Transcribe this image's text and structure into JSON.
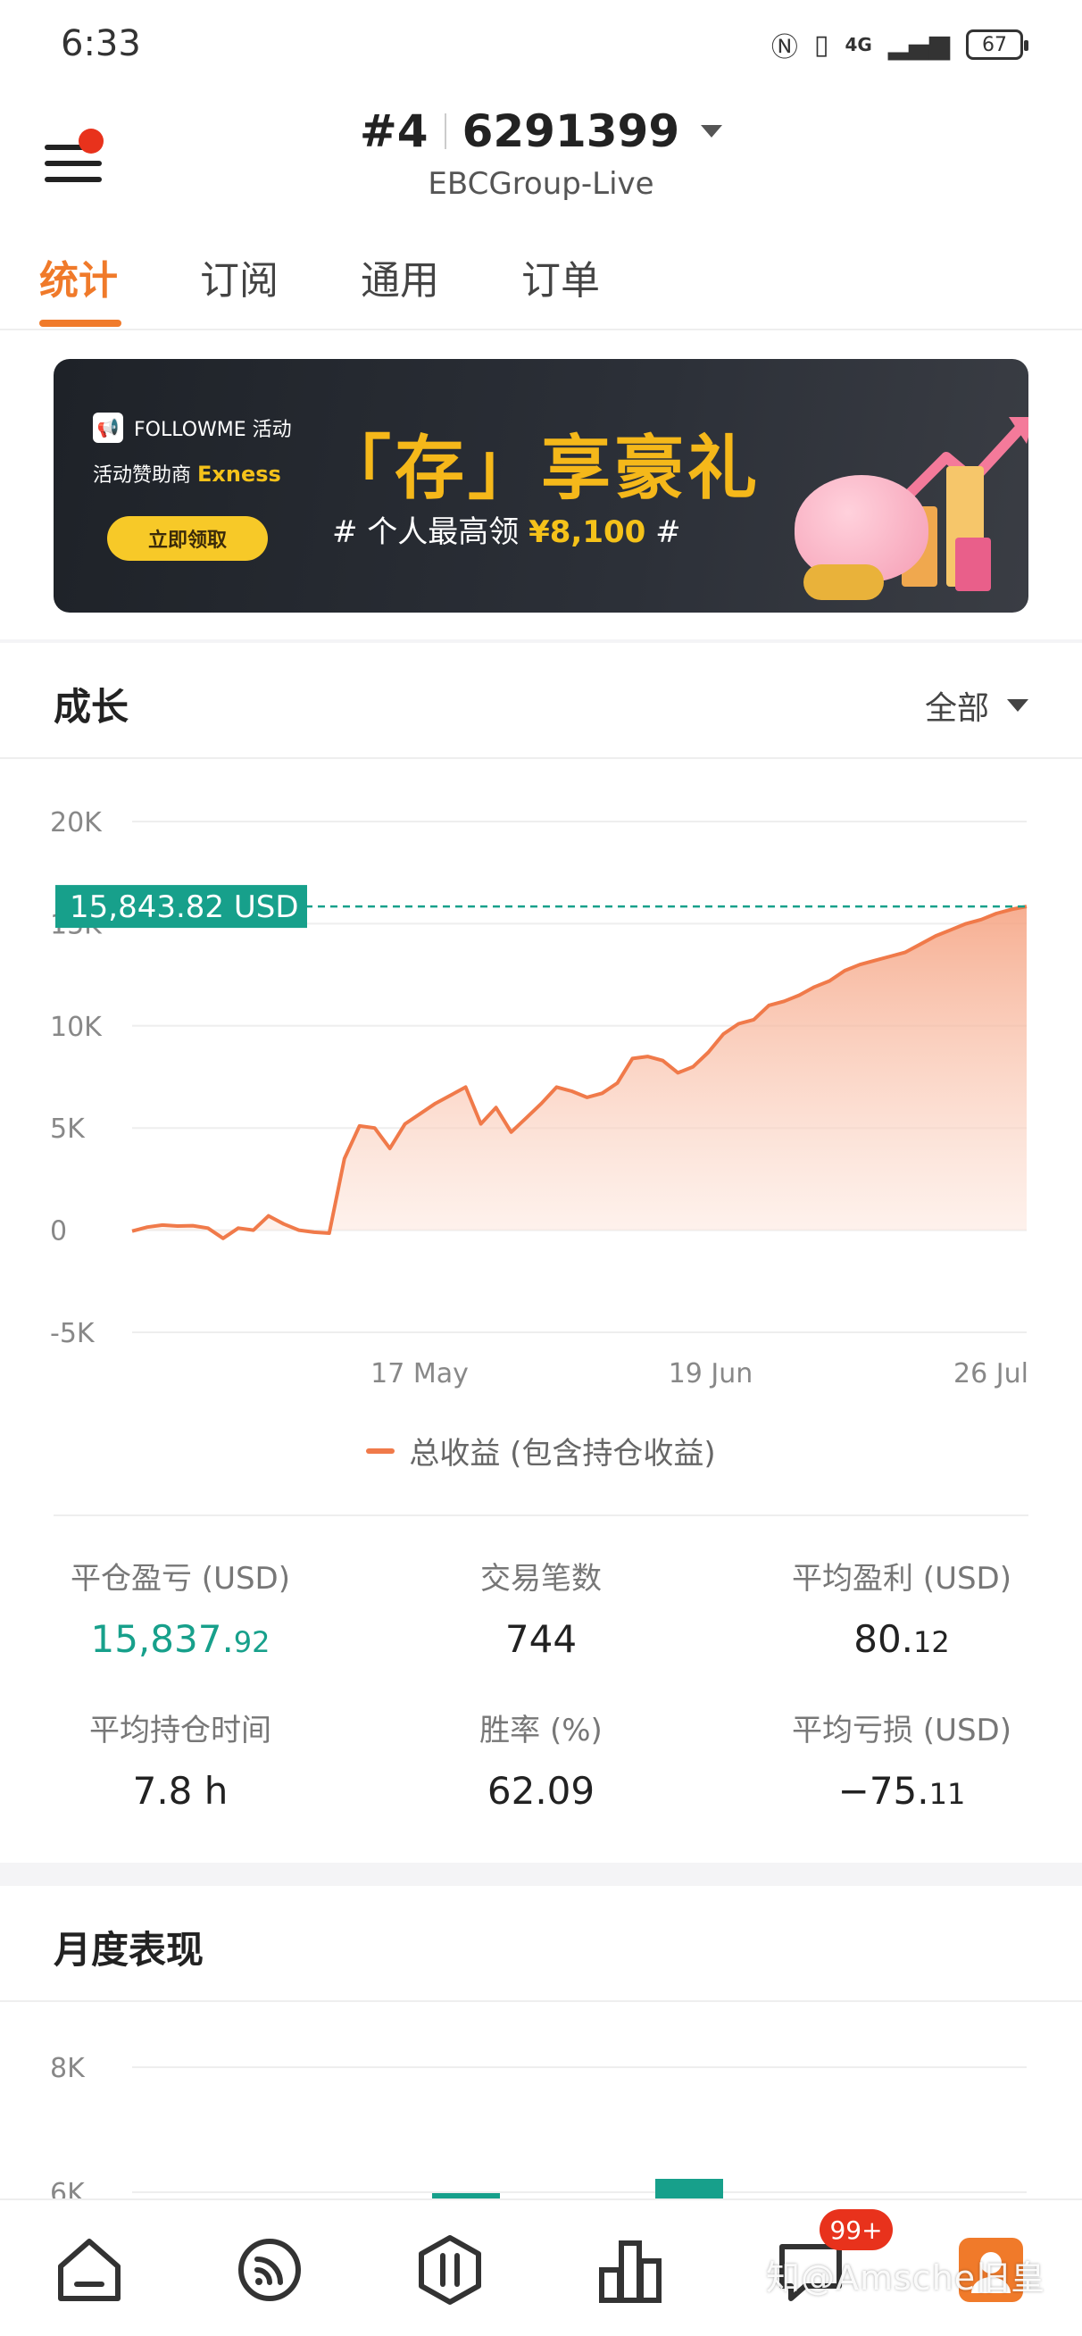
{
  "status_bar": {
    "time": "6:33",
    "icons": [
      "nfc-icon",
      "vibrate-icon",
      "signal-icon"
    ],
    "network": "4G",
    "battery": "67"
  },
  "header": {
    "rank": "#4",
    "account": "6291399",
    "server": "EBCGroup-Live"
  },
  "tabs": [
    {
      "label": "统计",
      "active": true
    },
    {
      "label": "订阅",
      "active": false
    },
    {
      "label": "通用",
      "active": false
    },
    {
      "label": "订单",
      "active": false
    }
  ],
  "banner": {
    "brand": "FOLLOWME 活动",
    "sponsor_prefix": "活动赞助商",
    "sponsor": "Exness",
    "button": "立即领取",
    "title": "「存」享豪礼",
    "sub_prefix": "# 个人最高领",
    "sub_amount": "¥8,100",
    "sub_suffix": "#"
  },
  "growth": {
    "title": "成长",
    "filter": "全部",
    "current_value_label": "15,843.82 USD",
    "legend": "总收益 (包含持仓收益)"
  },
  "chart_data": {
    "type": "area",
    "title": "",
    "xlabel": "",
    "ylabel": "",
    "x_tick_labels": [
      "17 May",
      "19 Jun",
      "26 Jul"
    ],
    "y_tick_labels": [
      "20K",
      "15K",
      "10K",
      "5K",
      "0",
      "-5K"
    ],
    "ylim": [
      -5000,
      20000
    ],
    "grid": true,
    "series": [
      {
        "name": "总收益 (包含持仓收益)",
        "color": "#f07a4a",
        "values": [
          -50,
          150,
          250,
          200,
          220,
          100,
          -400,
          100,
          0,
          700,
          300,
          0,
          -100,
          -150,
          3500,
          5100,
          5000,
          4000,
          5200,
          5700,
          6200,
          6600,
          7000,
          5200,
          6000,
          4800,
          5500,
          6200,
          7000,
          6800,
          6500,
          6700,
          7200,
          8400,
          8500,
          8300,
          7700,
          8000,
          8700,
          9600,
          10100,
          10300,
          11000,
          11200,
          11500,
          11900,
          12200,
          12700,
          13000,
          13200,
          13400,
          13600,
          14000,
          14400,
          14700,
          15000,
          15200,
          15500,
          15700,
          15843.82
        ]
      }
    ],
    "reference_value": 15843.82
  },
  "stats": [
    {
      "label": "平仓盈亏 (USD)",
      "int": "15,837.",
      "dec": "92",
      "color": "#17a08b"
    },
    {
      "label": "交易笔数",
      "int": "744",
      "dec": "",
      "color": "#222222"
    },
    {
      "label": "平均盈利 (USD)",
      "int": "80.",
      "dec": "12",
      "color": "#222222"
    },
    {
      "label": "平均持仓时间",
      "int": "7.8 h",
      "dec": "",
      "color": "#222222"
    },
    {
      "label": "胜率 (%)",
      "int": "62.09",
      "dec": "",
      "color": "#222222"
    },
    {
      "label": "平均亏损 (USD)",
      "int": "−75.",
      "dec": "11",
      "color": "#222222"
    }
  ],
  "monthly": {
    "title": "月度表现",
    "y_tick_labels": [
      "8K",
      "6K"
    ]
  },
  "bottom_nav": {
    "items": [
      "home-icon",
      "feed-icon",
      "trade-icon",
      "ranking-icon",
      "chat-icon",
      "profile-icon"
    ],
    "badge": "99+",
    "watermark": "知@Amsche旧皇"
  }
}
